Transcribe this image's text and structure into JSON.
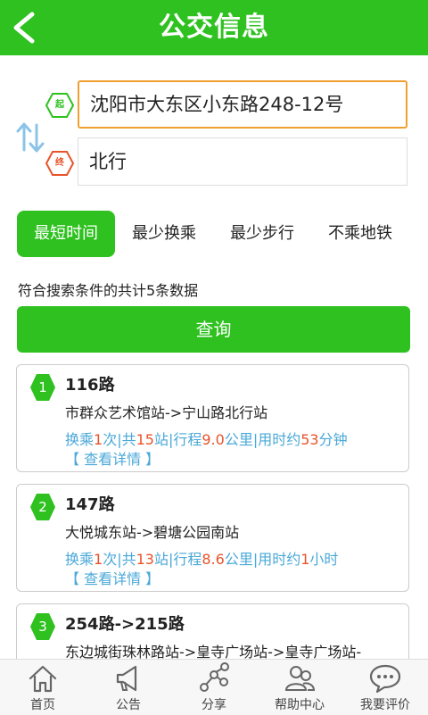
{
  "header": {
    "title": "公交信息"
  },
  "route": {
    "start_tag": "起",
    "end_tag": "终",
    "start_value": "沈阳市大东区小东路248-12号",
    "end_value": "北行"
  },
  "options": [
    {
      "label": "最短时间",
      "active": true
    },
    {
      "label": "最少换乘",
      "active": false
    },
    {
      "label": "最少步行",
      "active": false
    },
    {
      "label": "不乘地铁",
      "active": false
    }
  ],
  "summary": "符合搜索条件的共计5条数据",
  "query_label": "查询",
  "results": [
    {
      "index": "1",
      "name": "116路",
      "stops": "市群众艺术馆站->宁山路北行站",
      "info": {
        "transfer_prefix": "换乘",
        "transfers": "1",
        "transfers_unit": "次|共",
        "stations": "15",
        "stations_unit": "站|行程",
        "distance": "9.0",
        "distance_unit": "公里|用时约",
        "time": "53",
        "time_unit": "分钟"
      },
      "detail": "【 查看详情 】"
    },
    {
      "index": "2",
      "name": "147路",
      "stops": "大悦城东站->碧塘公园南站",
      "info": {
        "transfer_prefix": "换乘",
        "transfers": "1",
        "transfers_unit": "次|共",
        "stations": "13",
        "stations_unit": "站|行程",
        "distance": "8.6",
        "distance_unit": "公里|用时约",
        "time": "1",
        "time_unit": "小时"
      },
      "detail": "【 查看详情 】"
    },
    {
      "index": "3",
      "name": "254路->215路",
      "stops": "东边城街珠林路站->皇寺广场站->皇寺广场站-"
    }
  ],
  "tabbar": [
    {
      "label": "首页",
      "icon": "home-icon"
    },
    {
      "label": "公告",
      "icon": "megaphone-icon"
    },
    {
      "label": "分享",
      "icon": "share-icon"
    },
    {
      "label": "帮助中心",
      "icon": "help-center-icon"
    },
    {
      "label": "我要评价",
      "icon": "comment-icon"
    }
  ],
  "colors": {
    "primary": "#2ec11f",
    "accent_orange": "#e8532a",
    "link_blue": "#4aa8d8",
    "focus_border": "#f0a030"
  }
}
